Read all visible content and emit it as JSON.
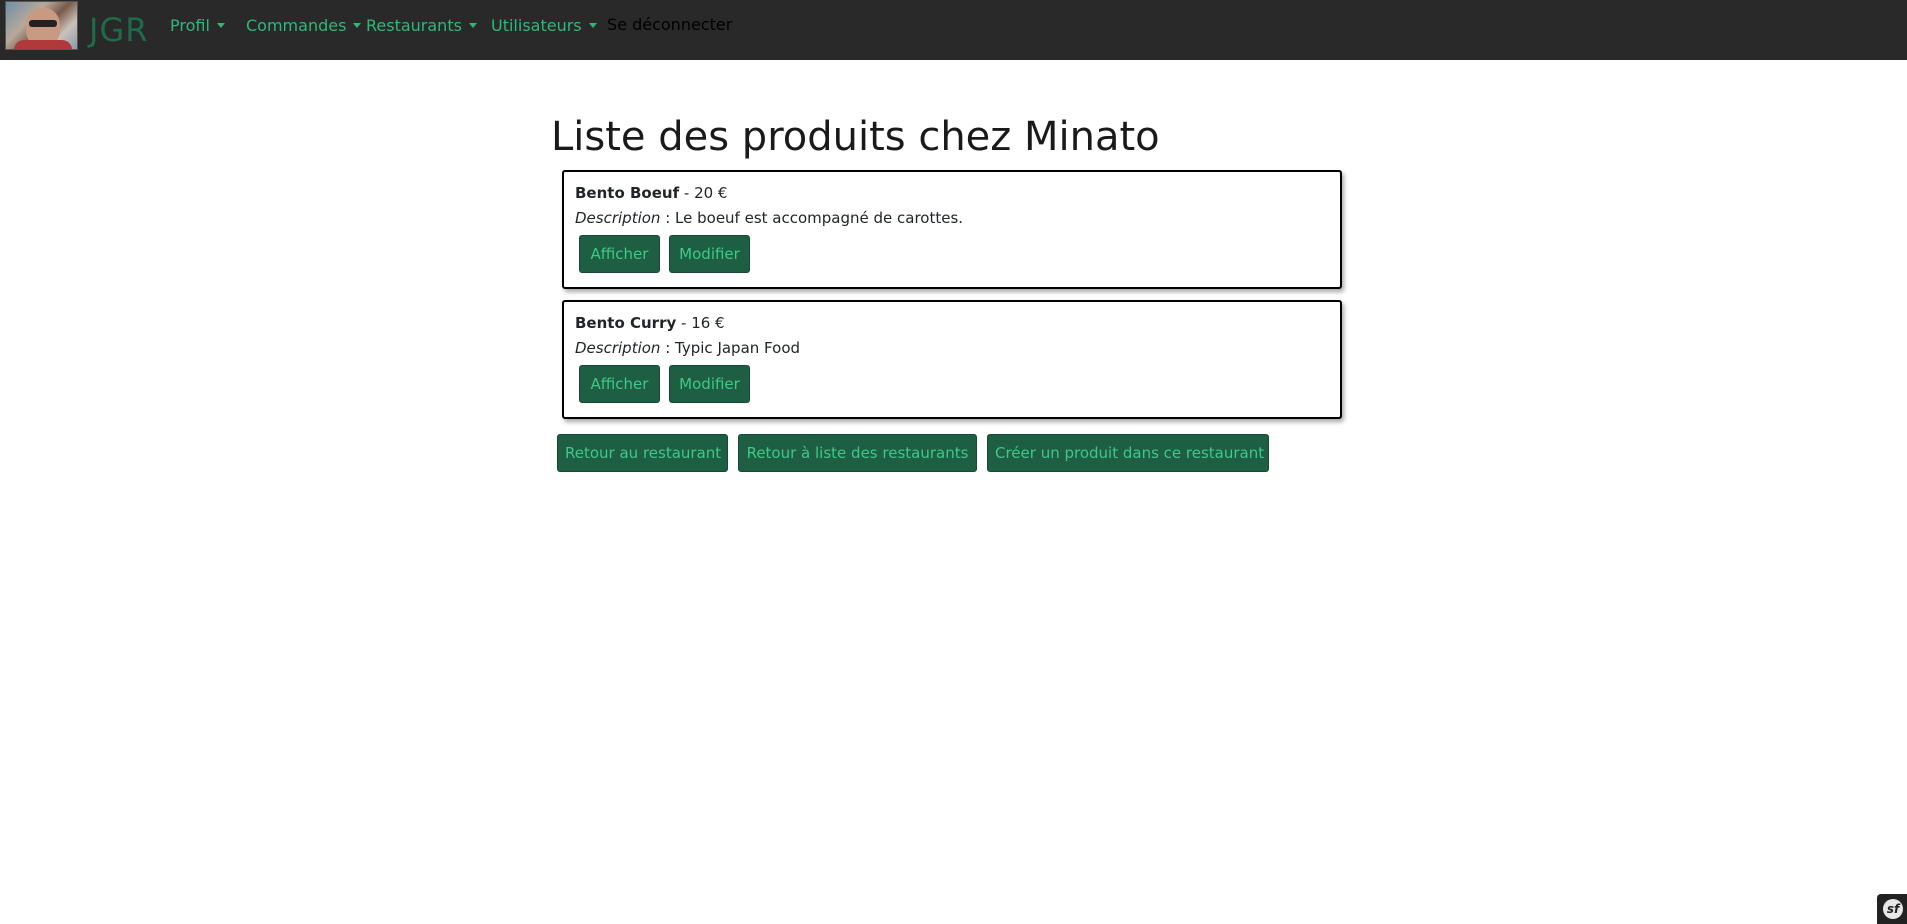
{
  "navbar": {
    "brand": "JGR",
    "items": [
      {
        "label": "Profil"
      },
      {
        "label": "Commandes"
      },
      {
        "label": "Restaurants"
      },
      {
        "label": "Utilisateurs"
      }
    ],
    "logout_label": "Se déconnecter"
  },
  "page": {
    "title": "Liste des produits chez Minato"
  },
  "products": [
    {
      "name": "Bento Boeuf",
      "separator": " - ",
      "price": "20 €",
      "description_label": "Description",
      "description_sep": " : ",
      "description": "Le boeuf est accompagné de carottes.",
      "show_label": "Afficher",
      "edit_label": "Modifier"
    },
    {
      "name": "Bento Curry",
      "separator": " - ",
      "price": "16 €",
      "description_label": "Description",
      "description_sep": " : ",
      "description": "Typic Japan Food",
      "show_label": "Afficher",
      "edit_label": "Modifier"
    }
  ],
  "actions": {
    "back_restaurant": "Retour au restaurant",
    "back_list": "Retour à liste des restaurants",
    "create_product": "Créer un produit dans ce restaurant"
  },
  "colors": {
    "navbar_bg": "#292929",
    "brand": "#1e6b4a",
    "nav_link": "#2fb878",
    "button_bg": "#1e5e42",
    "button_text": "#3fc88a"
  },
  "icons": {
    "dropdown": "caret-down-icon",
    "debug_toolbar": "symfony-logo-icon"
  }
}
